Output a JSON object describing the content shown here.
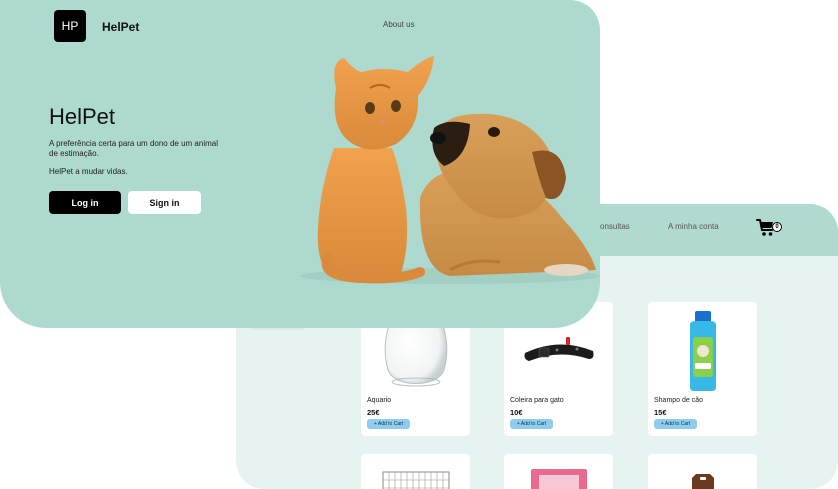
{
  "front": {
    "logo_text": "HP",
    "brand": "HelPet",
    "nav_about": "About us",
    "hero_title": "HelPet",
    "hero_description": "A preferência certa para um dono de um animal de estimação.",
    "hero_slogan": "HelPet a mudar vidas.",
    "login_label": "Log in",
    "signin_label": "Sign in"
  },
  "shop": {
    "nav_consultas": "consultas",
    "nav_account": "A minha conta",
    "cart_count": "0",
    "add_to_cart_label": "+ Add to Cart",
    "products": [
      {
        "name": "Aquario",
        "price": "25€",
        "icon": "fishbowl-image"
      },
      {
        "name": "Coleira para gato",
        "price": "10€",
        "icon": "cat-collar-image"
      },
      {
        "name": "Shampo de cão",
        "price": "15€",
        "icon": "dog-shampoo-image"
      }
    ]
  },
  "colors": {
    "front_bg": "#aed9ce",
    "back_header": "#b0dacf",
    "back_bg": "#e7f3f0",
    "add_button": "#8ecdf0"
  }
}
